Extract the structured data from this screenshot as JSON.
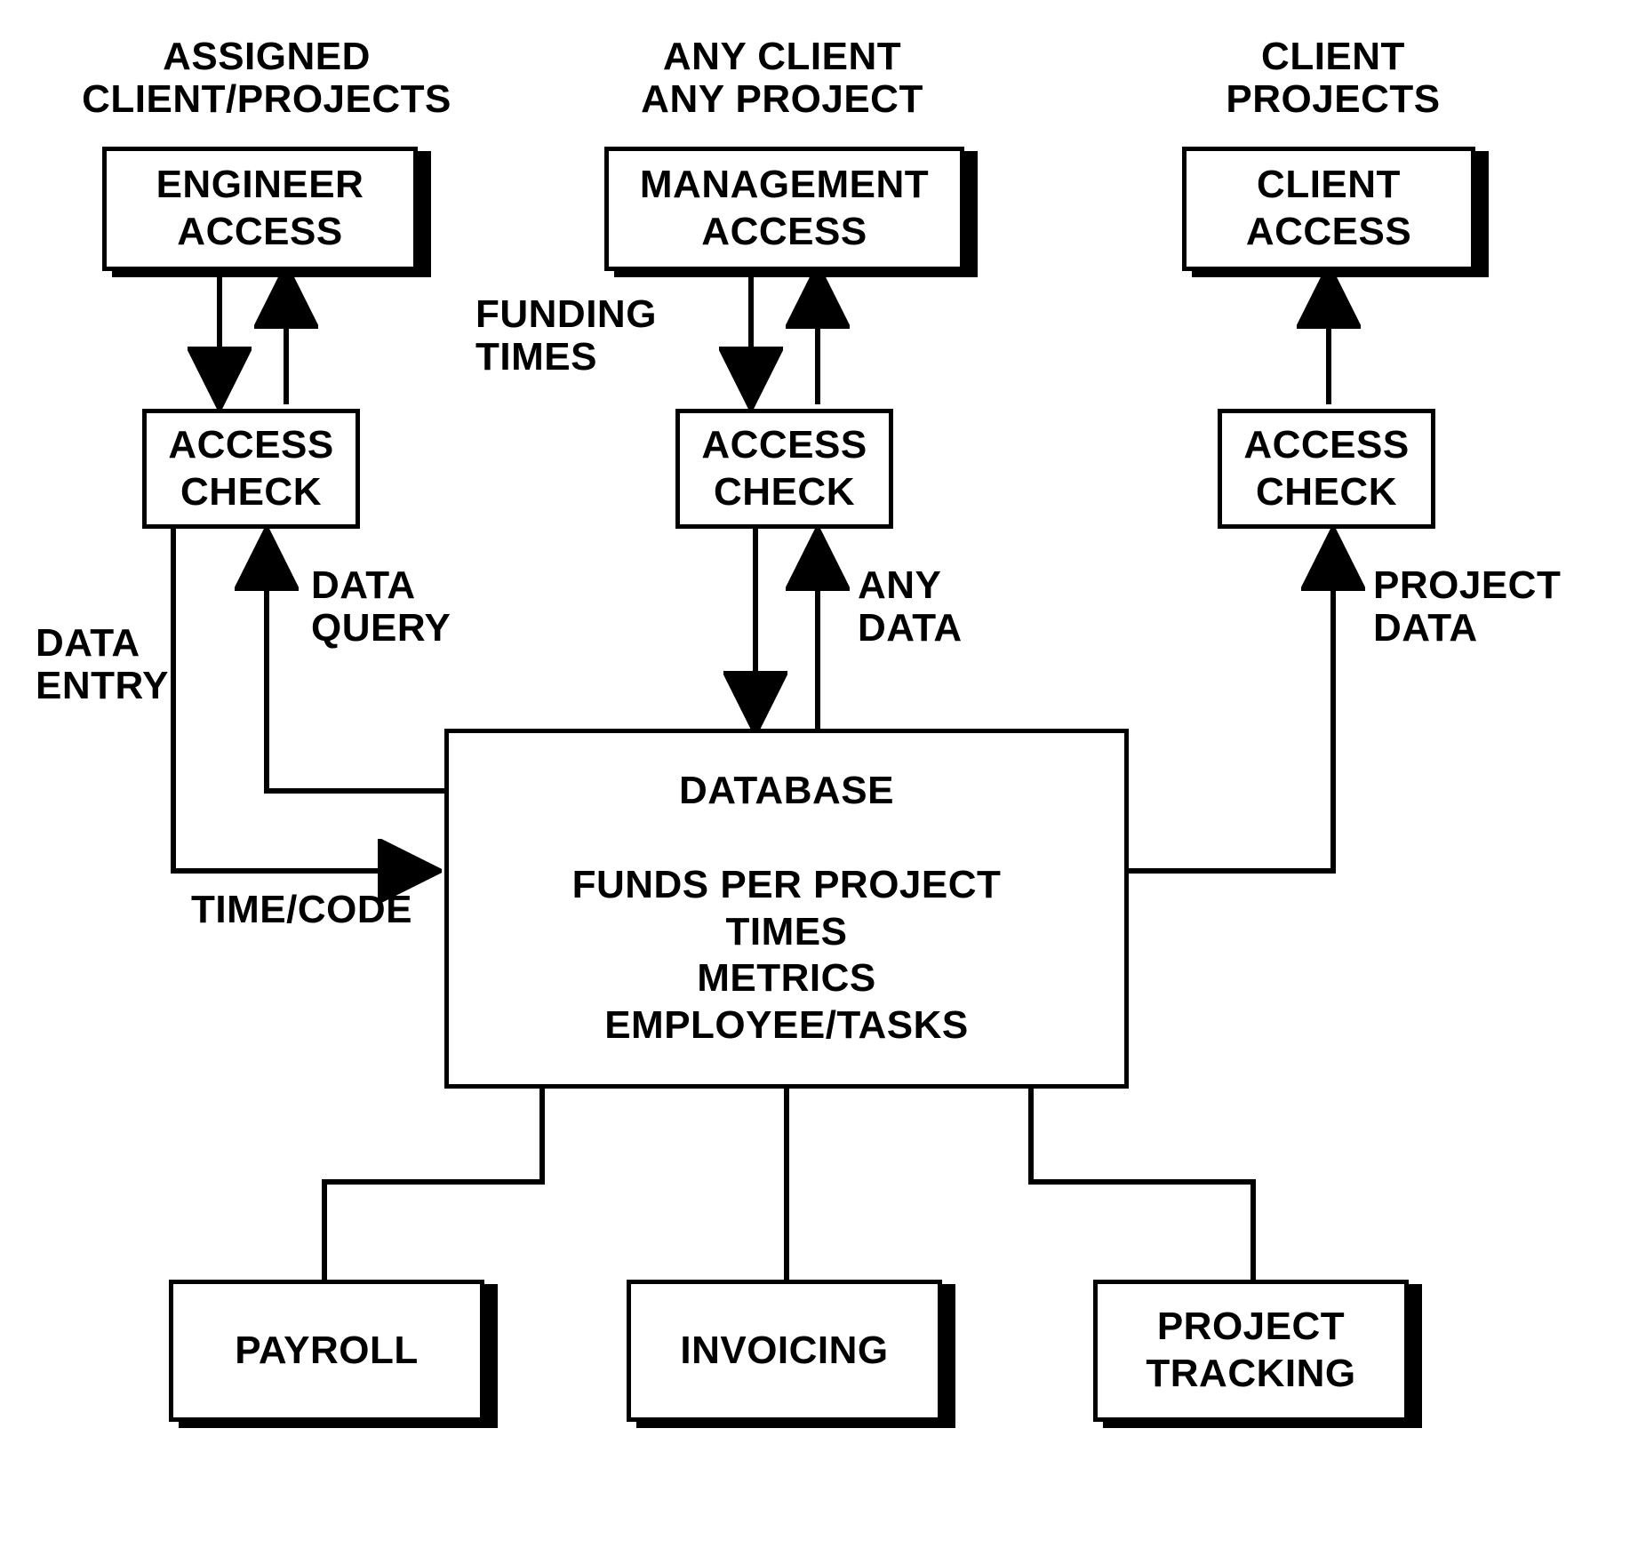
{
  "headers": {
    "engineer": "ASSIGNED\nCLIENT/PROJECTS",
    "management": "ANY CLIENT\nANY PROJECT",
    "client": "CLIENT\nPROJECTS"
  },
  "boxes": {
    "engineer_access": "ENGINEER\nACCESS",
    "management_access": "MANAGEMENT\nACCESS",
    "client_access": "CLIENT\nACCESS",
    "access_check_1": "ACCESS\nCHECK",
    "access_check_2": "ACCESS\nCHECK",
    "access_check_3": "ACCESS\nCHECK",
    "database": "DATABASE\n\nFUNDS PER PROJECT\nTIMES\nMETRICS\nEMPLOYEE/TASKS",
    "payroll": "PAYROLL",
    "invoicing": "INVOICING",
    "project_tracking": "PROJECT\nTRACKING"
  },
  "labels": {
    "funding_times": "FUNDING\nTIMES",
    "data_entry": "DATA\nENTRY",
    "data_query": "DATA\nQUERY",
    "any_data": "ANY\nDATA",
    "project_data": "PROJECT\nDATA",
    "time_code": "TIME/CODE"
  }
}
